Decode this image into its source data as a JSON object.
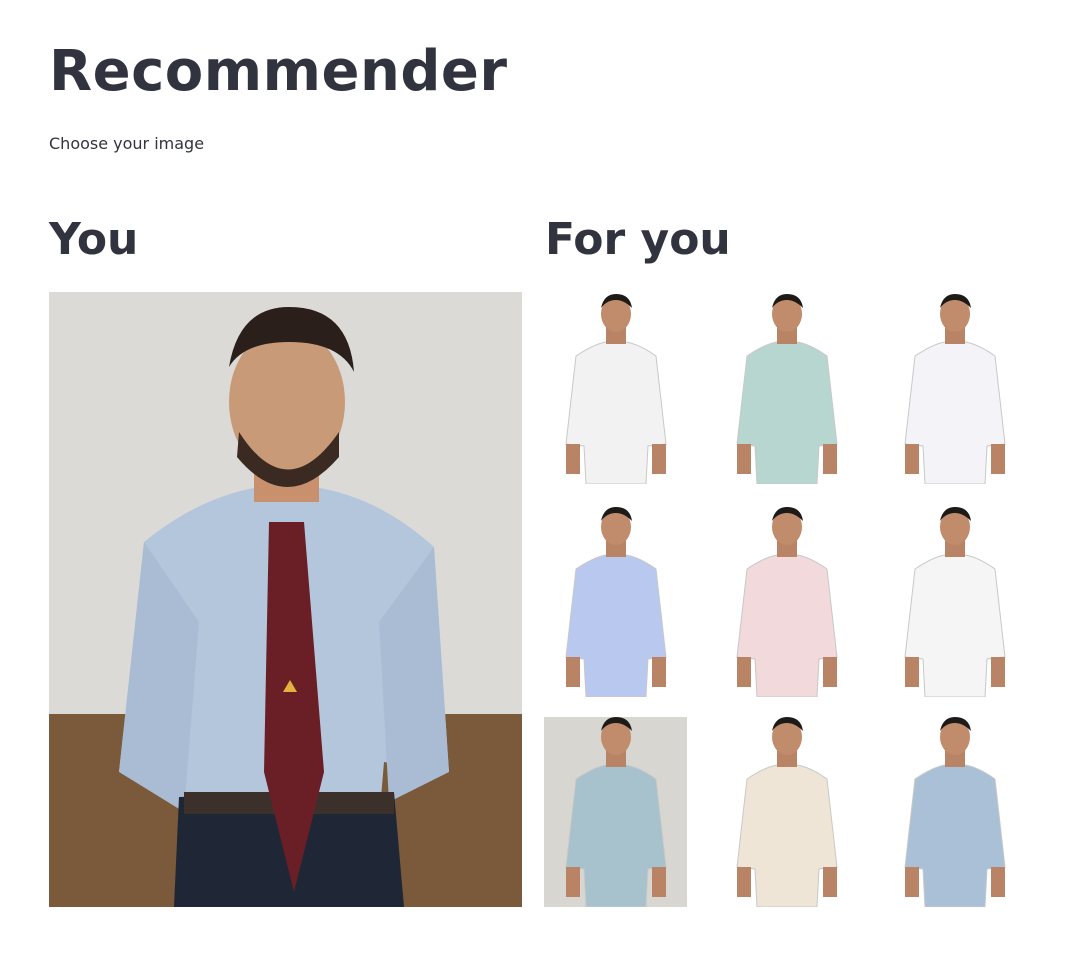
{
  "page": {
    "title": "Recommender",
    "subtitle": "Choose your image"
  },
  "columns": {
    "you_heading": "You",
    "for_you_heading": "For you"
  },
  "user_image": {
    "icon": "person-photo",
    "shirt_color": "#b4c6dc",
    "tie_color": "#6a1f26",
    "wall_color": "#dcdad6",
    "floor_color": "#7a5a3a"
  },
  "recommendations": [
    {
      "icon": "sleeveless-sport-top",
      "color": "#f2f2f2",
      "bg": "#ffffff"
    },
    {
      "icon": "mint-striped-shirt",
      "color": "#b7d6cf",
      "bg": "#ffffff"
    },
    {
      "icon": "white-sport-tee",
      "color": "#f4f4f8",
      "bg": "#ffffff"
    },
    {
      "icon": "lavender-polo",
      "color": "#b9c8ee",
      "bg": "#ffffff"
    },
    {
      "icon": "pink-shirt",
      "color": "#f1d9dc",
      "bg": "#ffffff"
    },
    {
      "icon": "graphic-tee",
      "color": "#f5f5f5",
      "bg": "#ffffff"
    },
    {
      "icon": "puma-blue-tee",
      "color": "#a7c2cc",
      "bg": "#d8d6d0"
    },
    {
      "icon": "beige-shirt",
      "color": "#eee5d6",
      "bg": "#ffffff"
    },
    {
      "icon": "check-shirt",
      "color": "#a9c0d6",
      "bg": "#ffffff"
    }
  ]
}
